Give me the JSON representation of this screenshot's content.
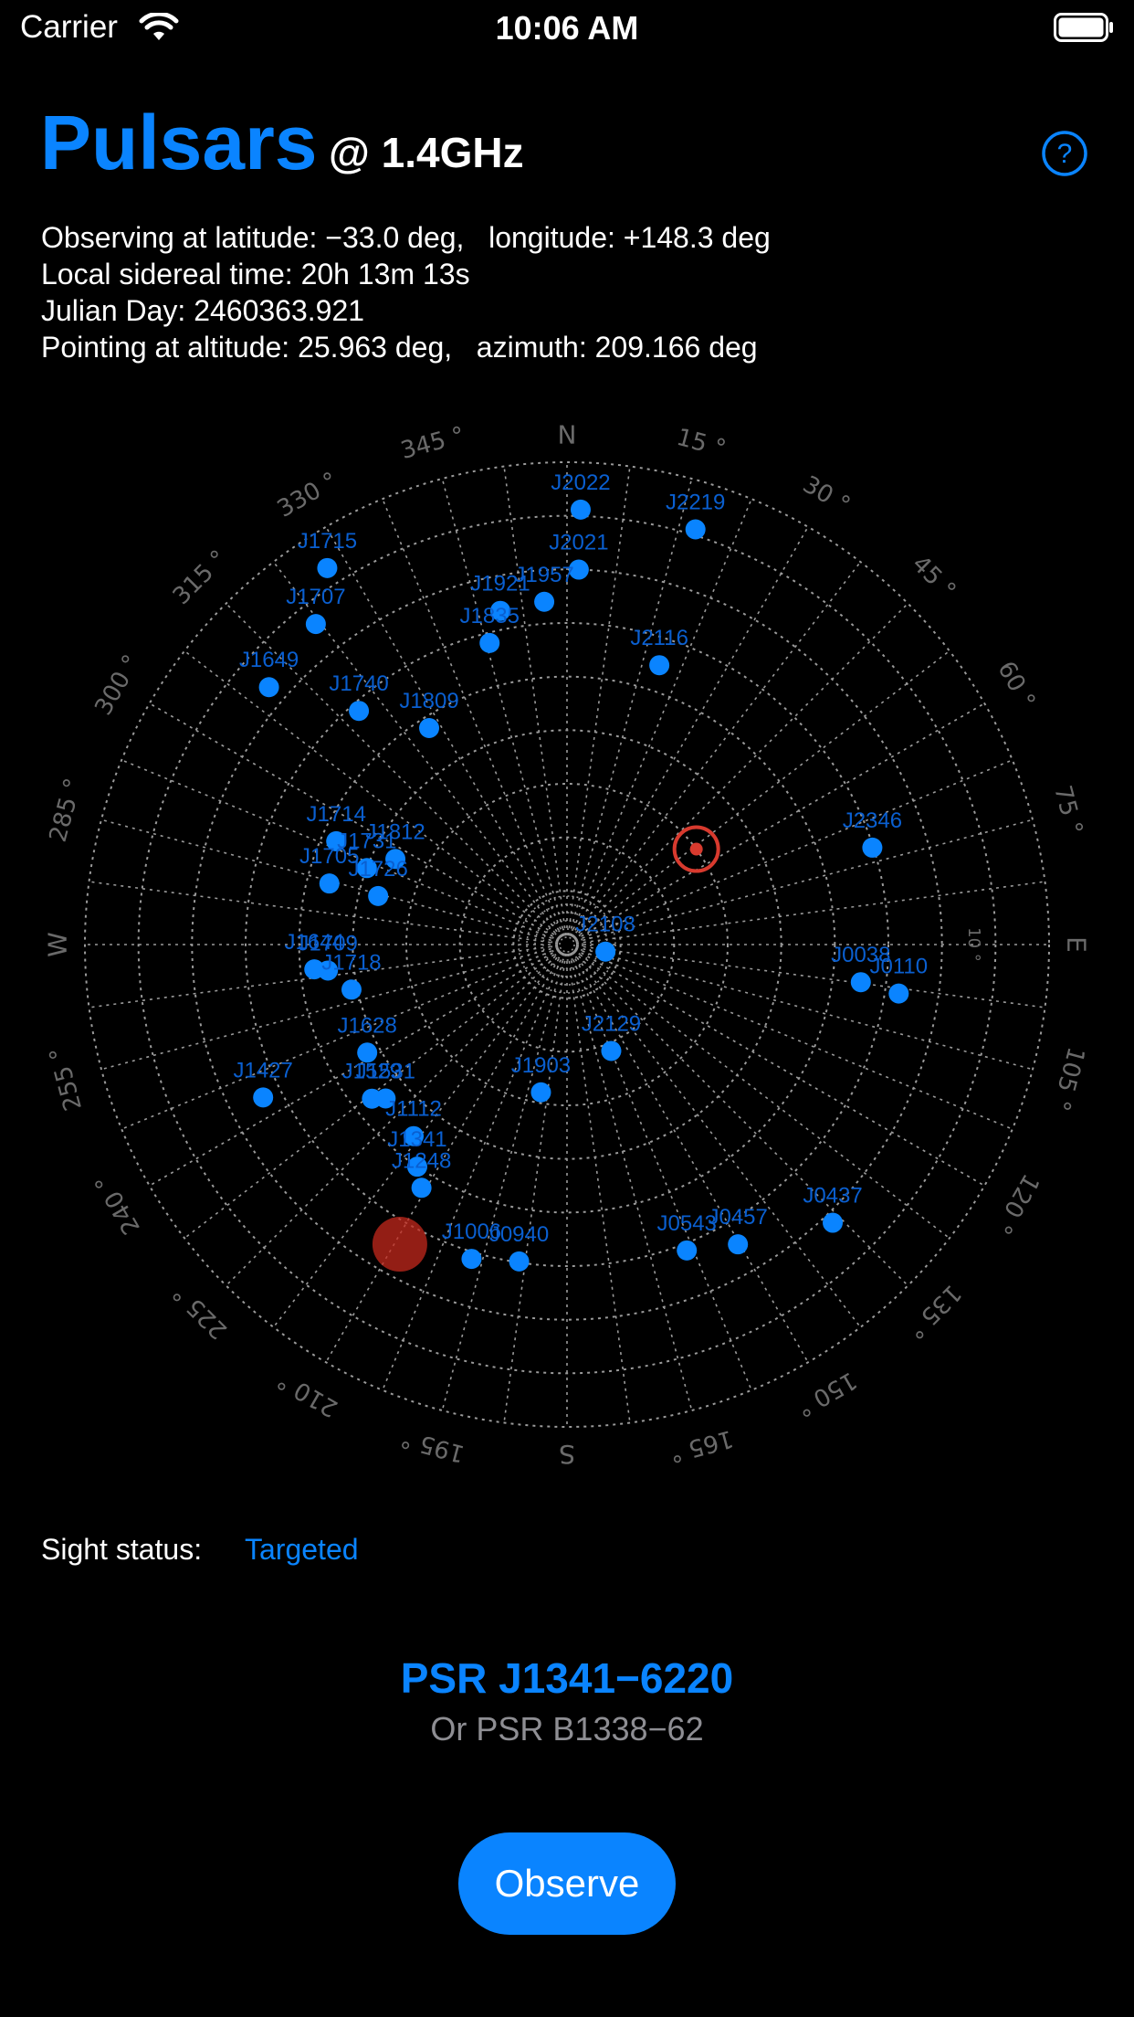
{
  "status_bar": {
    "carrier": "Carrier",
    "time": "10:06 AM"
  },
  "header": {
    "title": "Pulsars",
    "frequency": "@ 1.4GHz"
  },
  "info_lines": [
    "Observing at latitude: −33.0 deg,   longitude: +148.3 deg",
    "Local sidereal time: 20h 13m 13s",
    "Julian Day: 2460363.921",
    "Pointing at altitude: 25.963 deg,   azimuth: 209.166 deg"
  ],
  "sky_chart": {
    "direction_labels": {
      "north": "N",
      "east": "E",
      "south": "S",
      "west": "W"
    },
    "azimuth_labels": [
      {
        "az": 15,
        "text": "15 °"
      },
      {
        "az": 30,
        "text": "30 °"
      },
      {
        "az": 45,
        "text": "45 °"
      },
      {
        "az": 60,
        "text": "60 °"
      },
      {
        "az": 75,
        "text": "75 °"
      },
      {
        "az": 105,
        "text": "105 °"
      },
      {
        "az": 120,
        "text": "120 °"
      },
      {
        "az": 135,
        "text": "135 °"
      },
      {
        "az": 150,
        "text": "150 °"
      },
      {
        "az": 165,
        "text": "165 °"
      },
      {
        "az": 195,
        "text": "195 °"
      },
      {
        "az": 210,
        "text": "210 °"
      },
      {
        "az": 225,
        "text": "225 °"
      },
      {
        "az": 240,
        "text": "240 °"
      },
      {
        "az": 255,
        "text": "255 °"
      },
      {
        "az": 285,
        "text": "285 °"
      },
      {
        "az": 300,
        "text": "300 °"
      },
      {
        "az": 315,
        "text": "315 °"
      },
      {
        "az": 330,
        "text": "330 °"
      },
      {
        "az": 345,
        "text": "345 °"
      }
    ],
    "altitude_label": {
      "alt": 10,
      "text": "10 °"
    },
    "pulsars": [
      {
        "name": "J2022",
        "az": 1.8,
        "alt": 8.8
      },
      {
        "name": "J2219",
        "az": 17.2,
        "alt": 8.9
      },
      {
        "name": "J1715",
        "az": 327.5,
        "alt": 6.7
      },
      {
        "name": "J2021",
        "az": 1.8,
        "alt": 20.0
      },
      {
        "name": "J1707",
        "az": 321.9,
        "alt": 14.0
      },
      {
        "name": "J1957",
        "az": 356.2,
        "alt": 25.9
      },
      {
        "name": "J1921",
        "az": 348.7,
        "alt": 26.5
      },
      {
        "name": "J1835",
        "az": 345.6,
        "alt": 31.9
      },
      {
        "name": "J1649",
        "az": 310.8,
        "alt": 16.5
      },
      {
        "name": "J2116",
        "az": 18.3,
        "alt": 35.1
      },
      {
        "name": "J1740",
        "az": 318.3,
        "alt": 31.6
      },
      {
        "name": "J1809",
        "az": 327.5,
        "alt": 42.1
      },
      {
        "name": "J2346",
        "az": 72.4,
        "alt": 30.2
      },
      {
        "name": "J1714",
        "az": 294.1,
        "alt": 42.8
      },
      {
        "name": "J1812",
        "az": 296.5,
        "alt": 54.2
      },
      {
        "name": "J1731",
        "az": 290.9,
        "alt": 50.0
      },
      {
        "name": "J1705",
        "az": 284.4,
        "alt": 44.2
      },
      {
        "name": "J1726",
        "az": 284.4,
        "alt": 53.6
      },
      {
        "name": "J2108",
        "az": 100.4,
        "alt": 82.7
      },
      {
        "name": "J1644",
        "az": 264.4,
        "alt": 42.6
      },
      {
        "name": "J1709",
        "az": 263.8,
        "alt": 45.1
      },
      {
        "name": "J1718",
        "az": 258.2,
        "alt": 48.9
      },
      {
        "name": "J0038",
        "az": 97.3,
        "alt": 34.7
      },
      {
        "name": "J0110",
        "az": 98.4,
        "alt": 27.4
      },
      {
        "name": "J1628",
        "az": 241.6,
        "alt": 47.6
      },
      {
        "name": "J2129",
        "az": 157.4,
        "alt": 68.5
      },
      {
        "name": "J1427",
        "az": 243.3,
        "alt": 26.5
      },
      {
        "name": "J1529",
        "az": 231.7,
        "alt": 43.6
      },
      {
        "name": "J1531",
        "az": 229.7,
        "alt": 45.6
      },
      {
        "name": "J1903",
        "az": 190.0,
        "alt": 62.0
      },
      {
        "name": "J1112",
        "az": 218.7,
        "alt": 44.2
      },
      {
        "name": "J1341",
        "az": 214.0,
        "alt": 40.0
      },
      {
        "name": "J1248",
        "az": 210.9,
        "alt": 37.1
      },
      {
        "name": "J0437",
        "az": 136.3,
        "alt": 18.2
      },
      {
        "name": "J0457",
        "az": 150.3,
        "alt": 25.6
      },
      {
        "name": "J0543",
        "az": 158.6,
        "alt": 28.7
      },
      {
        "name": "J0940",
        "az": 188.6,
        "alt": 30.2
      },
      {
        "name": "J1006",
        "az": 196.9,
        "alt": 28.7
      }
    ],
    "pointing": {
      "az": 209.166,
      "alt": 25.963
    },
    "target_circle": {
      "az": 53.6,
      "alt": 60.0
    },
    "colors": {
      "grid": "#9a9a9a",
      "pulsar": "#0a84ff",
      "label": "#0a5fd0",
      "reticle": "#d83a2e",
      "pointer": "#c4281c",
      "axis_text": "#6a6a6a"
    }
  },
  "sight_status": {
    "label": "Sight status:",
    "value": "Targeted"
  },
  "target": {
    "name": "PSR J1341−6220",
    "alt_name": "Or PSR B1338−62"
  },
  "observe_button": {
    "label": "Observe"
  },
  "colors": {
    "accent": "#0a84ff",
    "secondary_text": "#8e8e93"
  }
}
